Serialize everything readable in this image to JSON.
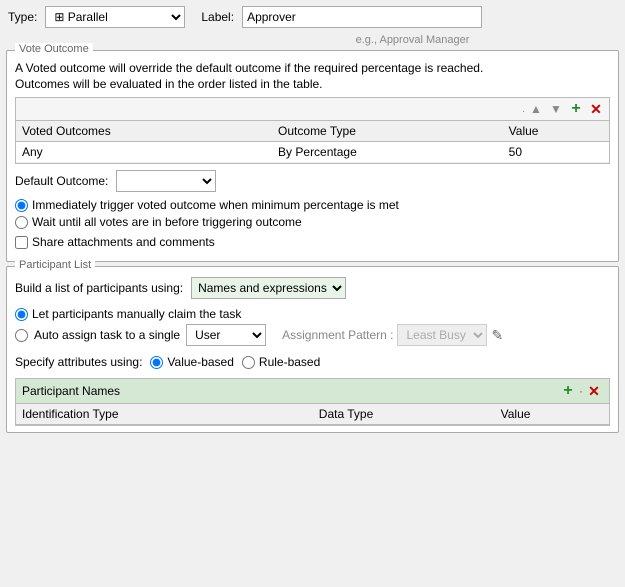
{
  "header": {
    "type_label": "Type:",
    "type_value": "Parallel",
    "label_label": "Label:",
    "label_value": "Approver",
    "label_placeholder": "e.g., Approval Manager",
    "type_icon": "⊞"
  },
  "vote_outcome": {
    "section_title": "Vote Outcome",
    "desc1": "A Voted outcome will override the default outcome if the required percentage is reached.",
    "desc2": "Outcomes will be evaluated in the order listed in the table.",
    "dot": ".",
    "table": {
      "columns": [
        "Voted Outcomes",
        "Outcome Type",
        "Value"
      ],
      "rows": [
        {
          "voted": "Any",
          "type": "By Percentage",
          "value": "50"
        }
      ]
    },
    "default_outcome_label": "Default Outcome:",
    "radio1": "Immediately trigger voted outcome when minimum percentage is met",
    "radio2": "Wait until all votes are in before triggering outcome",
    "checkbox": "Share attachments and comments"
  },
  "participant_list": {
    "section_title": "Participant List",
    "build_label": "Build a list of participants using:",
    "build_value": "Names and expressions",
    "radio_manual": "Let participants manually claim the task",
    "radio_auto": "Auto assign task to a single",
    "auto_type": "User",
    "assignment_pattern_label": "Assignment Pattern :",
    "assignment_pattern_value": "Least Busy",
    "specify_label": "Specify attributes using:",
    "radio_value_based": "Value-based",
    "radio_rule_based": "Rule-based",
    "table_title": "Participant Names",
    "table_columns": [
      "Identification Type",
      "Data Type",
      "Value"
    ]
  },
  "toolbar_buttons": {
    "up": "▲",
    "down": "▼",
    "add": "+",
    "remove": "✕"
  }
}
